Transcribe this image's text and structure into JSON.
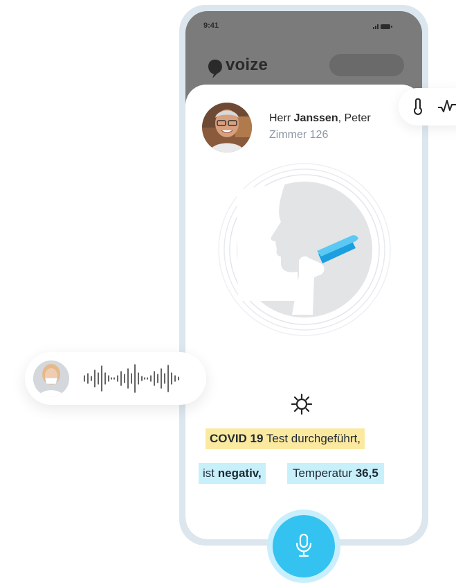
{
  "status_bar": {
    "time": "9:41",
    "signal_icon": "signal-icon",
    "battery_icon": "battery-icon"
  },
  "app": {
    "logo_icon": "speech-bubble-icon",
    "logo_text": "voize"
  },
  "patient": {
    "salutation": "Herr",
    "last_name": "Janssen",
    "first_name_suffix": ", Peter",
    "room": "Zimmer 126"
  },
  "vitals": {
    "icons": [
      "thermometer-icon",
      "pulse-icon"
    ]
  },
  "voice_message": {
    "icon": "waveform-icon"
  },
  "transcript": {
    "line1_bold": "COVID 19",
    "line1_rest": " Test durchgeführt,",
    "line2_prefix": "ist ",
    "line2_bold": "negativ,",
    "line3_prefix": "Temperatur ",
    "line3_bold": "36,5"
  },
  "controls": {
    "settings_icon": "gear-icon",
    "mic_icon": "microphone-icon"
  },
  "colors": {
    "accent": "#34c3f0",
    "highlight_yellow": "#fbe9a0",
    "highlight_blue": "#c8f0fb",
    "header_gray": "#7b7b7b",
    "frame": "#dce6ee"
  }
}
